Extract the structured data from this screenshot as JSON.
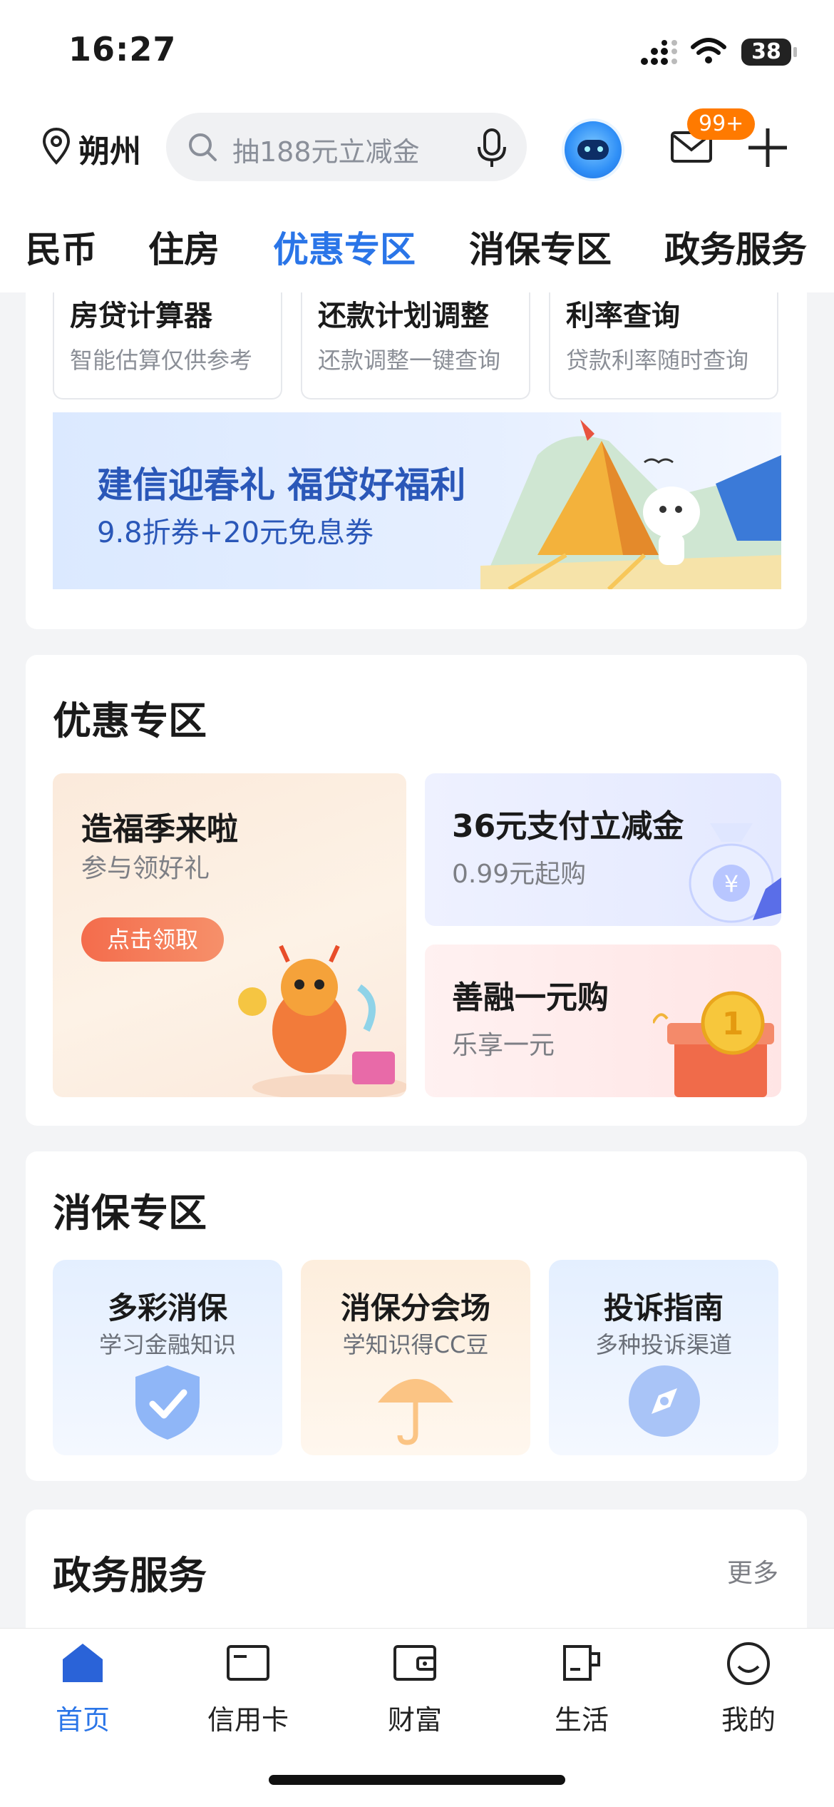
{
  "status_bar": {
    "time": "16:27",
    "battery": "38"
  },
  "header": {
    "location": "朔州",
    "search_placeholder": "抽188元立减金",
    "mail_badge": "99+"
  },
  "tabs": [
    {
      "label": "民币",
      "active": false
    },
    {
      "label": "住房",
      "active": false
    },
    {
      "label": "优惠专区",
      "active": true
    },
    {
      "label": "消保专区",
      "active": false
    },
    {
      "label": "政务服务",
      "active": false
    }
  ],
  "tools": [
    {
      "title": "房贷计算器",
      "subtitle": "智能估算仅供参考"
    },
    {
      "title": "还款计划调整",
      "subtitle": "还款调整一键查询"
    },
    {
      "title": "利率查询",
      "subtitle": "贷款利率随时查询"
    }
  ],
  "banner": {
    "title": "建信迎春礼 福贷好福利",
    "subtitle": "9.8折券+20元免息券"
  },
  "promo_section": {
    "title": "优惠专区",
    "left": {
      "title": "造福季来啦",
      "subtitle": "参与领好礼",
      "button": "点击领取"
    },
    "right_top": {
      "title": "36元支付立减金",
      "subtitle": "0.99元起购"
    },
    "right_bottom": {
      "title": "善融一元购",
      "subtitle": "乐享一元"
    }
  },
  "consumer_section": {
    "title": "消保专区",
    "items": [
      {
        "title": "多彩消保",
        "subtitle": "学习金融知识",
        "icon": "shield-check-icon"
      },
      {
        "title": "消保分会场",
        "subtitle": "学知识得CC豆",
        "icon": "umbrella-icon"
      },
      {
        "title": "投诉指南",
        "subtitle": "多种投诉渠道",
        "icon": "compass-icon"
      }
    ]
  },
  "gov_section": {
    "title": "政务服务",
    "more": "更多"
  },
  "bottom_nav": [
    {
      "label": "首页",
      "icon": "home-icon",
      "active": true
    },
    {
      "label": "信用卡",
      "icon": "credit-card-icon",
      "active": false
    },
    {
      "label": "财富",
      "icon": "wallet-icon",
      "active": false
    },
    {
      "label": "生活",
      "icon": "cup-icon",
      "active": false
    },
    {
      "label": "我的",
      "icon": "smile-icon",
      "active": false
    }
  ],
  "colors": {
    "accent": "#2a75e8",
    "badge": "#ff7a00",
    "claim_button": "#f46c4c"
  }
}
